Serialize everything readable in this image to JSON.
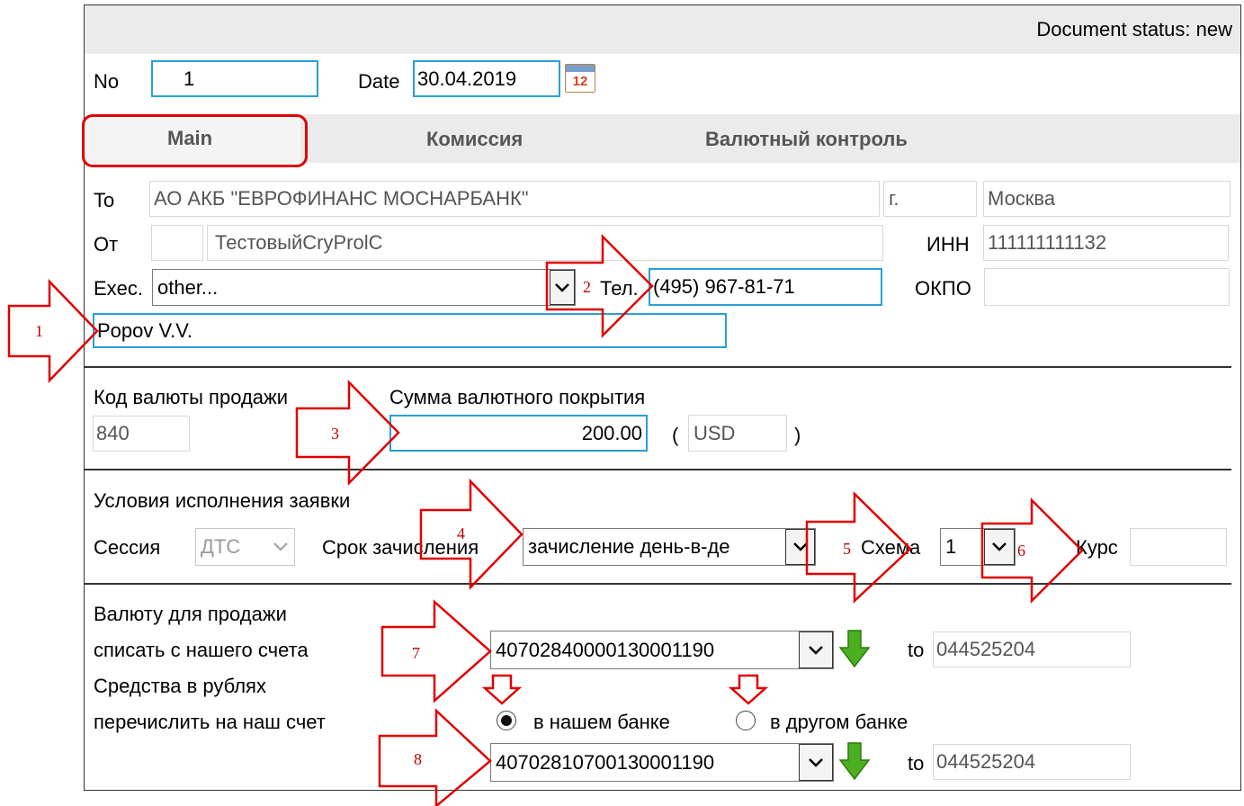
{
  "header": {
    "status_text": "Document status: new"
  },
  "doc": {
    "no_label": "No",
    "no_value": "1",
    "date_label": "Date",
    "date_value": "30.04.2019",
    "calendar_day": "12"
  },
  "tabs": [
    {
      "label": "Main"
    },
    {
      "label": "Комиссия"
    },
    {
      "label": "Валютный контроль"
    }
  ],
  "to": {
    "label": "To",
    "bank": "АО АКБ \"ЕВРОФИНАНС МОСНАРБАНК\"",
    "city_label": "г.",
    "city": "Москва"
  },
  "from": {
    "label": "От",
    "name": "ТестовыйCryProlC",
    "inn_label": "ИНН",
    "inn": "111111111132"
  },
  "exec": {
    "label": "Exec.",
    "value": "other...",
    "tel_label": "Тел.",
    "tel": "(495) 967-81-71",
    "okpo_label": "ОКПО",
    "okpo": "",
    "person": "Popov V.V."
  },
  "currency": {
    "code_label": "Код валюты продажи",
    "code": "840",
    "sum_label": "Сумма валютного покрытия",
    "sum": "200.00",
    "paren_open": "(",
    "cur": "USD",
    "paren_close": ")"
  },
  "conditions": {
    "title": "Условия исполнения заявки",
    "session_label": "Сессия",
    "session": "ДТС",
    "term_label": "Срок зачисления",
    "term": "зачисление день-в-де",
    "scheme_label": "Схема",
    "scheme": "1",
    "rate_label": "Курс",
    "rate": ""
  },
  "accounts": {
    "sell_label1": "Валюту для продажи",
    "sell_label2": "списать с нашего счета",
    "sell_account": "40702840000130001190",
    "sell_to_label": "to",
    "sell_bic": "044525204",
    "rub_label1": "Средства в рублях",
    "rub_label2": "перечислить на наш счет",
    "radio_our": "в нашем банке",
    "radio_other": "в другом банке",
    "selected": "в нашем банке",
    "rub_account": "40702810700130001190",
    "rub_to_label": "to",
    "rub_bic": "044525204"
  },
  "annotations": {
    "n1": "1",
    "n2": "2",
    "n3": "3",
    "n4": "4",
    "n5": "5",
    "n6": "6",
    "n7": "7",
    "n8": "8"
  },
  "colors": {
    "field_border_focus": "#2a9fd6",
    "annotation": "#e00000",
    "download_arrow": "#4caf20"
  }
}
